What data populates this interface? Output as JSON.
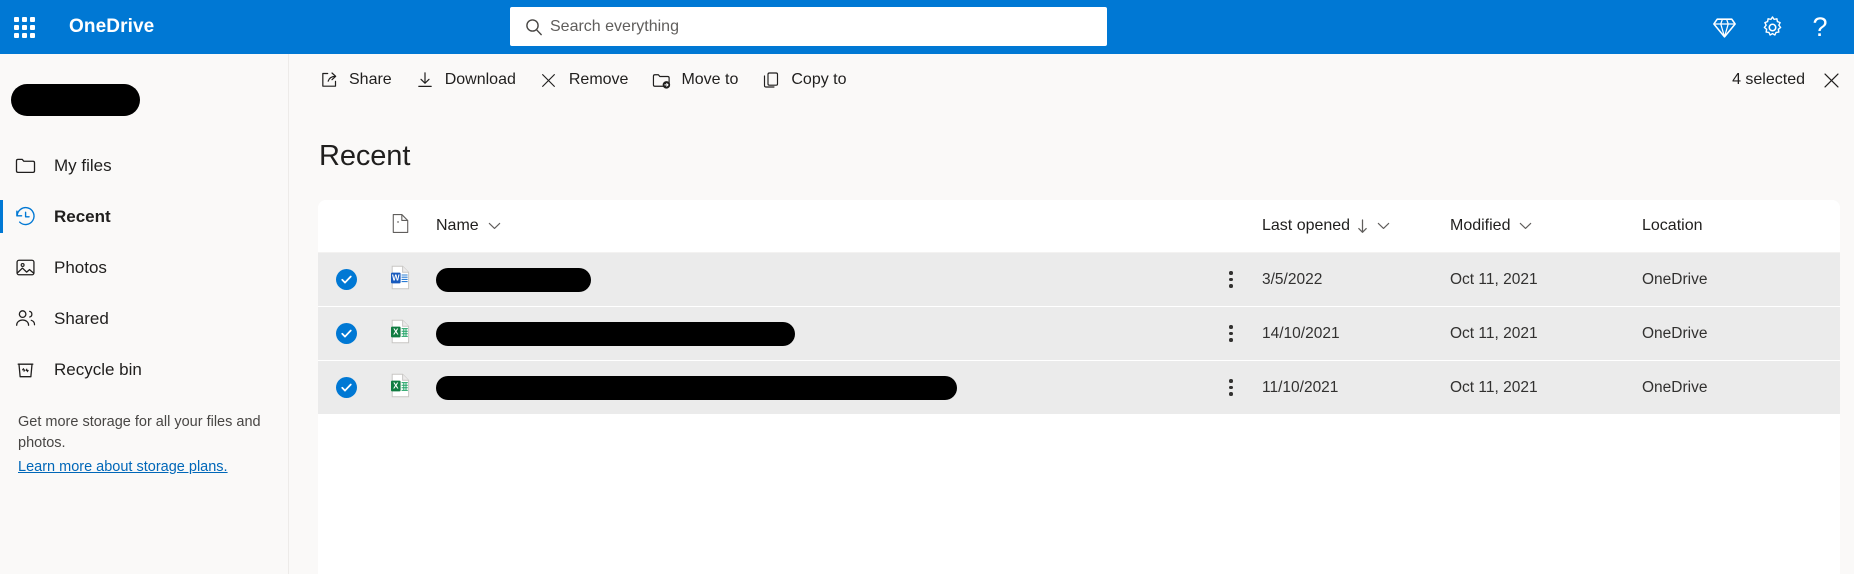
{
  "app": {
    "name": "OneDrive",
    "waffle_icon": "app-launcher-waffle-icon",
    "accent_color": "#0078d4"
  },
  "search": {
    "placeholder": "Search everything",
    "value": "",
    "icon": "search-icon"
  },
  "suite_actions": [
    {
      "name": "premium-diamond-icon",
      "label": "Premium"
    },
    {
      "name": "settings-gear-icon",
      "label": "Settings"
    },
    {
      "name": "help-question-icon",
      "label": "Help",
      "glyph": "?"
    }
  ],
  "sidebar": {
    "account_name_redacted": true,
    "items": [
      {
        "label": "My files",
        "icon": "folder-icon",
        "selected": false
      },
      {
        "label": "Recent",
        "icon": "recent-clock-icon",
        "selected": true
      },
      {
        "label": "Photos",
        "icon": "photos-image-icon",
        "selected": false
      },
      {
        "label": "Shared",
        "icon": "shared-people-icon",
        "selected": false
      },
      {
        "label": "Recycle bin",
        "icon": "recycle-bin-icon",
        "selected": false
      }
    ],
    "storage_note": "Get more storage for all your files and photos.",
    "storage_link": "Learn more about storage plans."
  },
  "command_bar": {
    "commands": [
      {
        "label": "Share",
        "icon": "share-icon"
      },
      {
        "label": "Download",
        "icon": "download-icon"
      },
      {
        "label": "Remove",
        "icon": "remove-x-icon"
      },
      {
        "label": "Move to",
        "icon": "move-to-folder-icon"
      },
      {
        "label": "Copy to",
        "icon": "copy-to-icon"
      }
    ],
    "selection_text": "4 selected",
    "close_icon": "close-selection-icon"
  },
  "main": {
    "page_title": "Recent"
  },
  "table": {
    "columns": [
      {
        "key": "type",
        "label": "",
        "icon": "file-type-icon"
      },
      {
        "key": "name",
        "label": "Name",
        "sort": "none",
        "has_chevron": true
      },
      {
        "key": "last_opened",
        "label": "Last opened",
        "sort": "desc",
        "has_chevron": true
      },
      {
        "key": "modified",
        "label": "Modified",
        "sort": "none",
        "has_chevron": true
      },
      {
        "key": "location",
        "label": "Location",
        "sort": "none",
        "has_chevron": false
      }
    ],
    "rows": [
      {
        "selected": true,
        "file_type": "word",
        "name_redacted_width": 155,
        "last_opened": "3/5/2022",
        "modified": "Oct 11, 2021",
        "location": "OneDrive"
      },
      {
        "selected": true,
        "file_type": "excel",
        "name_redacted_width": 359,
        "last_opened": "14/10/2021",
        "modified": "Oct 11, 2021",
        "location": "OneDrive"
      },
      {
        "selected": true,
        "file_type": "excel",
        "name_redacted_width": 521,
        "last_opened": "11/10/2021",
        "modified": "Oct 11, 2021",
        "location": "OneDrive"
      }
    ]
  }
}
